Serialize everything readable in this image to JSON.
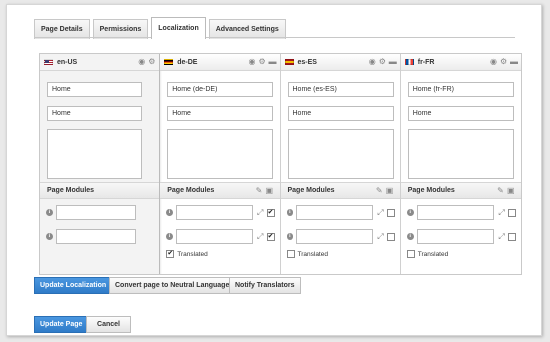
{
  "tabs": [
    {
      "label": "Page Details"
    },
    {
      "label": "Permissions"
    },
    {
      "label": "Localization"
    },
    {
      "label": "Advanced Settings"
    }
  ],
  "active_tab": "Localization",
  "page_modules_label": "Page Modules",
  "translated_label": "Translated",
  "icons": {
    "view": "eye-icon",
    "settings": "gear-icon",
    "delete": "trash-icon",
    "edit": "pencil-icon",
    "translate": "translate-icon",
    "info": "info-icon",
    "link": "link-icon"
  },
  "cultures": [
    {
      "code": "en-US",
      "flag": "us",
      "title": "Home",
      "name": "Home",
      "neutral": true
    },
    {
      "code": "de-DE",
      "flag": "de",
      "title": "Home (de-DE)",
      "name": "Home",
      "translated": true,
      "module_checked": [
        true,
        true
      ]
    },
    {
      "code": "es-ES",
      "flag": "es",
      "title": "Home (es-ES)",
      "name": "Home",
      "translated": false,
      "module_checked": [
        false,
        false
      ]
    },
    {
      "code": "fr-FR",
      "flag": "fr",
      "title": "Home (fr-FR)",
      "name": "Home",
      "translated": false,
      "module_checked": [
        false,
        false
      ]
    }
  ],
  "buttons": {
    "update_localization": "Update Localization",
    "convert_neutral": "Convert page to Neutral Language",
    "notify_translators": "Notify Translators",
    "update_page": "Update Page",
    "cancel": "Cancel"
  },
  "colors": {
    "primary_button": "#2f7bc8",
    "neutral_column_bg": "#f3f3f3"
  }
}
